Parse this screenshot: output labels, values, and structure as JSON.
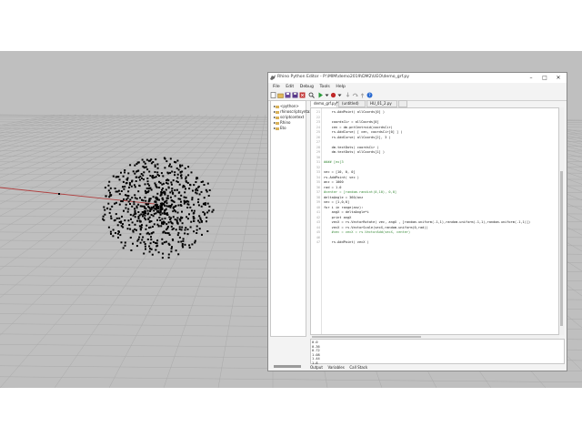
{
  "window": {
    "title": "Rhino Python Editor - P:\\MIM\\demo2019\\DM2\\UEO\\demo_grf.py",
    "minimize": "–",
    "maximize": "□",
    "close": "✕"
  },
  "menu": [
    "File",
    "Edit",
    "Debug",
    "Tools",
    "Help"
  ],
  "toolbar_icons": [
    "new-file-icon",
    "open-folder-icon",
    "save-icon",
    "save-all-icon",
    "close-file-icon",
    "search-icon",
    "run-icon",
    "run-dropdown-icon",
    "debug-icon",
    "stop-icon",
    "step-into-icon",
    "step-over-icon",
    "step-out-icon",
    "help-icon"
  ],
  "tree": {
    "items": [
      {
        "label": "<python>",
        "expander": "▸"
      },
      {
        "label": "rhinoscriptsyntax",
        "expander": "▸"
      },
      {
        "label": "scriptcontext",
        "expander": "▸"
      },
      {
        "label": "Rhino",
        "expander": "▸"
      },
      {
        "label": "Eto",
        "expander": "▸"
      }
    ]
  },
  "tabs": [
    {
      "label": "demo_grf.py*",
      "active": true
    },
    {
      "label": "(untitled)",
      "active": false
    },
    {
      "label": "HU_01_2.py",
      "active": false
    },
    {
      "label": "",
      "active": false
    }
  ],
  "code": {
    "lines": [
      {
        "n": "21",
        "text": "    rs.AddPoint( allCoords[0] )"
      },
      {
        "n": "22",
        "text": ""
      },
      {
        "n": "23",
        "text": "    coordsCir = allCoords[0]"
      },
      {
        "n": "24",
        "text": "    cen = dm.pntCentroid(coordsCir)"
      },
      {
        "n": "25",
        "text": "    rs.AddCurve( [ cen, coordsCir[0] ] )"
      },
      {
        "n": "26",
        "text": "    rs.AddCurve( allCoords[2], 3 )"
      },
      {
        "n": "27",
        "text": ""
      },
      {
        "n": "28",
        "text": "    dm.textDots( coordsCir )"
      },
      {
        "n": "29",
        "text": "    dm.textDots( allCoords[1] )"
      },
      {
        "n": "30",
        "text": ""
      },
      {
        "n": "31",
        "text": "#### [ex]3"
      },
      {
        "n": "32",
        "text": ""
      },
      {
        "n": "33",
        "text": "vec = [10, 0, 0]"
      },
      {
        "n": "34",
        "text": "rs.AddPoint( vec )"
      },
      {
        "n": "35",
        "text": "anz = 1000"
      },
      {
        "n": "36",
        "text": "rad = 1.0"
      },
      {
        "n": "37",
        "text": "#center = [random.randint(0,10), 0,0]"
      },
      {
        "n": "38",
        "text": "deltaAngle = 360/anz"
      },
      {
        "n": "39",
        "text": "vec = [1,0,0]"
      },
      {
        "n": "40",
        "text": "for i in range(anz):"
      },
      {
        "n": "41",
        "text": "    angX = deltaAngle*i"
      },
      {
        "n": "42",
        "text": "    print angX"
      },
      {
        "n": "43",
        "text": "    vecX = rs.VectorRotate( vec, angX , [random.uniform(-1,1),random.uniform(-1,1),random.uniform(-1,1)])"
      },
      {
        "n": "44",
        "text": "    vecX = rs.VectorScale(vecX,random.uniform(0,rad))"
      },
      {
        "n": "45",
        "text": "    #vec = vecX = rs.VectorAdd(vecX, center)"
      },
      {
        "n": "46",
        "text": ""
      },
      {
        "n": "47",
        "text": "    rs.AddPoint( vecX )"
      }
    ]
  },
  "output": {
    "lines": [
      "0.0",
      "0.36",
      "0.72",
      "1.08",
      "1.44",
      "1.8"
    ]
  },
  "bottom_tabs": [
    "Output",
    "Variables",
    "Call Stack"
  ],
  "colors": {
    "viewport_bg": "#bfbfbf",
    "grid_line": "#a9a9a9",
    "x_axis": "#b04040",
    "point": "#000000",
    "keyword": "#1a1a9a",
    "comment": "#3a8a3a"
  }
}
